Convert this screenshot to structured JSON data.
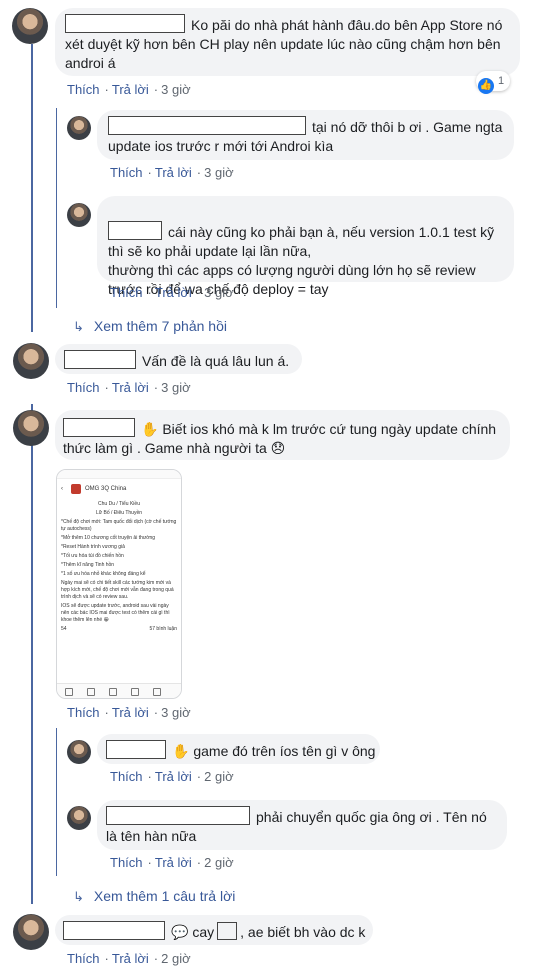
{
  "actions": {
    "like": "Thích",
    "reply": "Trả lời",
    "dot": "·"
  },
  "comments": [
    {
      "text": "Ko păi do nhà phát hành đâu.do bên App Store nó xét duyệt kỹ hơn bên CH play nên update lúc nào cũng chậm hơn bên androi á",
      "time": "3 giờ",
      "reactions": "1"
    },
    {
      "text": "tại nó dỡ thôi b ơi . Game ngta update ios trước r mới tới Androi kìa",
      "time": "3 giờ"
    },
    {
      "text": "cái này cũng ko phải bạn à, nếu version 1.0.1 test kỹ thì sẽ ko phải update lại lần nữa,\nthường thì các apps có lượng người dùng lớn họ sẽ review trước rồi để wa chế độ deploy = tay",
      "time": "3 giờ"
    },
    {
      "text": "Vấn đề là quá lâu lun á.",
      "time": "3 giờ"
    },
    {
      "text": "Biết ios khó mà k lm trước cứ tung ngày update chính thức làm gì . Game nhà người ta 😞",
      "time": "3 giờ"
    },
    {
      "text": "game đó trên íos tên gì v ông",
      "time": "2 giờ"
    },
    {
      "text": "phải chuyển quốc gia ông ơi . Tên nó là tên hàn nữa",
      "time": "2 giờ"
    },
    {
      "text": "cay",
      "text2": ", ae biết bh vào dc k",
      "time": "2 giờ"
    }
  ],
  "more_links": {
    "first": "Xem thêm 7 phản hồi",
    "second": "Xem thêm 1 câu trả lời"
  },
  "shared_image": {
    "app_name": "OMG 3Q China",
    "lines": [
      "Chu Du / Tiểu Kiều",
      "Lữ Bố / Điêu Thuyền",
      "*Chế độ chơi mới: Tam quốc đối dịch (cờ chế tướng tự autochess)",
      "*Mở thêm 10 chương cốt truyện ải thường",
      "*Reset Hành trình vương giả",
      "*Tối ưu hóa túi đồ chiến hồn",
      "*Thêm kĩ năng Tinh hồn",
      "*1 số ưu hóa nhỏ khác không đáng kể",
      "Ngày mai sẽ có chi tiết skill các tướng kim mới và hợp kích mới, chế độ chơi mới vẫn đang trong quá trình dịch và sẽ có review sau.",
      "IOS sẽ được update trước, android sau vài ngày nên các bác IOS mai được test có thêm cái gì thì khoe thêm lên nhé 😀"
    ],
    "likes": "54",
    "comments_count": "57 bình luận"
  },
  "colors": {
    "link": "#385898",
    "bubble": "#f2f3f5",
    "thread_line": "#4b67a1",
    "like": "#1877f2"
  }
}
